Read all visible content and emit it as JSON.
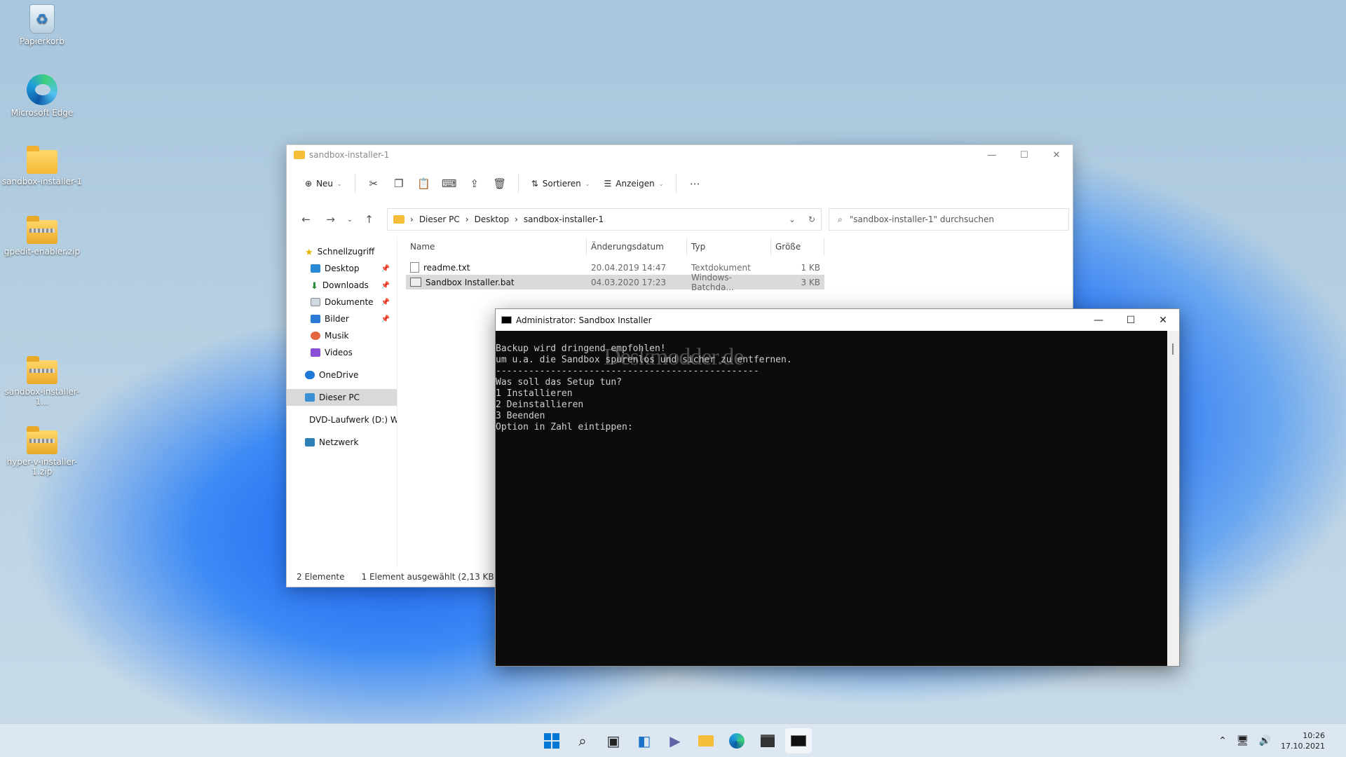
{
  "desktop": {
    "icons": [
      {
        "label": "Papierkorb",
        "kind": "recycle-bin-icon"
      },
      {
        "label": "Microsoft Edge",
        "kind": "edge-icon"
      },
      {
        "label": "sandbox-installer-1",
        "kind": "folder-icon"
      },
      {
        "label": "gpedit-enabler.zip",
        "kind": "zip-folder-icon"
      },
      {
        "label": "sandbox-installer-1...",
        "kind": "zip-folder-icon"
      },
      {
        "label": "hyper-v-installer-1.zip",
        "kind": "zip-folder-icon"
      }
    ]
  },
  "explorer": {
    "title": "sandbox-installer-1",
    "toolbar": {
      "new": "Neu",
      "sort": "Sortieren",
      "view": "Anzeigen"
    },
    "breadcrumb": [
      "Dieser PC",
      "Desktop",
      "sandbox-installer-1"
    ],
    "search_placeholder": "\"sandbox-installer-1\" durchsuchen",
    "nav": {
      "quick": "Schnellzugriff",
      "items": [
        "Desktop",
        "Downloads",
        "Dokumente",
        "Bilder",
        "Musik",
        "Videos"
      ],
      "onedrive": "OneDrive",
      "thispc": "Dieser PC",
      "dvd": "DVD-Laufwerk (D:) W",
      "network": "Netzwerk"
    },
    "columns": [
      "Name",
      "Änderungsdatum",
      "Typ",
      "Größe"
    ],
    "files": [
      {
        "name": "readme.txt",
        "date": "20.04.2019 14:47",
        "type": "Textdokument",
        "size": "1 KB"
      },
      {
        "name": "Sandbox Installer.bat",
        "date": "04.03.2020 17:23",
        "type": "Windows-Batchda...",
        "size": "3 KB"
      }
    ],
    "status": {
      "count": "2 Elemente",
      "selected": "1 Element ausgewählt (2,13 KB)"
    }
  },
  "cmd": {
    "title": "Administrator:  Sandbox Installer",
    "lines": [
      "Backup wird dringend empfohlen!",
      "um u.a. die Sandbox spurenlos und sicher zu entfernen.",
      "------------------------------------------------",
      "Was soll das Setup tun?",
      "1 Installieren",
      "2 Deinstallieren",
      "3 Beenden",
      "Option in Zahl eintippen:"
    ],
    "watermark": "Deskmodder.de"
  },
  "taskbar": {
    "time": "10:26",
    "date": "17.10.2021"
  },
  "colors": {
    "accent": "#0067c0",
    "folder": "#f5bd3a",
    "terminal_bg": "#0c0c0c"
  }
}
